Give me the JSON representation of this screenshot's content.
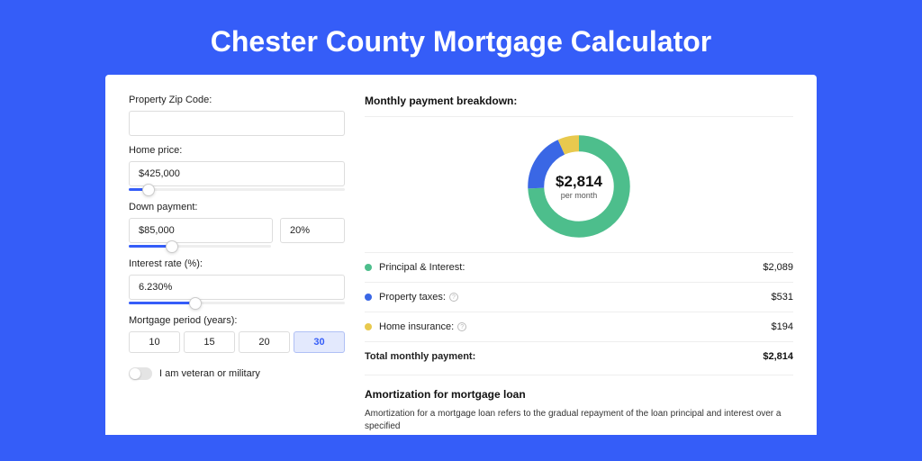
{
  "title": "Chester County Mortgage Calculator",
  "form": {
    "zip_label": "Property Zip Code:",
    "zip_value": "",
    "homeprice_label": "Home price:",
    "homeprice_value": "$425,000",
    "homeprice_slider_pct": 9,
    "downpayment_label": "Down payment:",
    "downpayment_value": "$85,000",
    "downpayment_pct_value": "20%",
    "downpayment_slider_pct": 20,
    "rate_label": "Interest rate (%):",
    "rate_value": "6.230%",
    "rate_slider_pct": 31,
    "period_label": "Mortgage period (years):",
    "period_options": [
      "10",
      "15",
      "20",
      "30"
    ],
    "period_selected": "30",
    "veteran_label": "I am veteran or military"
  },
  "breakdown": {
    "title": "Monthly payment breakdown:",
    "center_value": "$2,814",
    "center_sub": "per month",
    "items": [
      {
        "name": "Principal & Interest:",
        "value": "$2,089",
        "color": "green",
        "info": false
      },
      {
        "name": "Property taxes:",
        "value": "$531",
        "color": "blue",
        "info": true
      },
      {
        "name": "Home insurance:",
        "value": "$194",
        "color": "yellow",
        "info": true
      }
    ],
    "total_label": "Total monthly payment:",
    "total_value": "$2,814"
  },
  "amort": {
    "title": "Amortization for mortgage loan",
    "text": "Amortization for a mortgage loan refers to the gradual repayment of the loan principal and interest over a specified"
  },
  "chart_data": {
    "type": "pie",
    "title": "Monthly payment breakdown",
    "series": [
      {
        "name": "Principal & Interest",
        "value": 2089,
        "color": "#4DBE8C"
      },
      {
        "name": "Property taxes",
        "value": 531,
        "color": "#3A67E5"
      },
      {
        "name": "Home insurance",
        "value": 194,
        "color": "#E8C94E"
      }
    ],
    "total": 2814
  }
}
